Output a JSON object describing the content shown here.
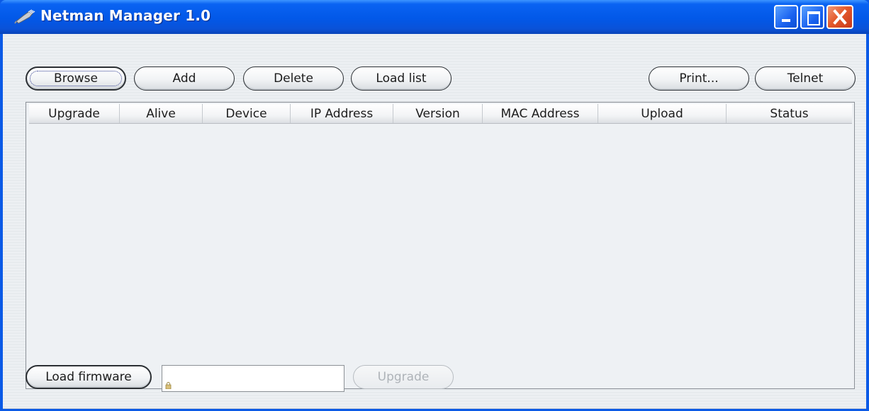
{
  "window": {
    "title": "Netman Manager 1.0",
    "controls": [
      "minimize",
      "maximize",
      "close"
    ]
  },
  "toolbar": {
    "browse": "Browse",
    "add": "Add",
    "delete": "Delete",
    "load_list": "Load list",
    "print": "Print...",
    "telnet": "Telnet"
  },
  "table": {
    "columns": [
      "Upgrade",
      "Alive",
      "Device",
      "IP Address",
      "Version",
      "MAC Address",
      "Upload",
      "Status"
    ],
    "rows": []
  },
  "footer": {
    "load_firmware": "Load firmware",
    "firmware_path": "",
    "upgrade": "Upgrade"
  },
  "icons": {
    "app": "network-cable-icon",
    "field": "lock-icon"
  },
  "colors": {
    "titlebar": "#0258e8",
    "close_button": "#e45a2c",
    "client_bg": "#edf0f3"
  }
}
